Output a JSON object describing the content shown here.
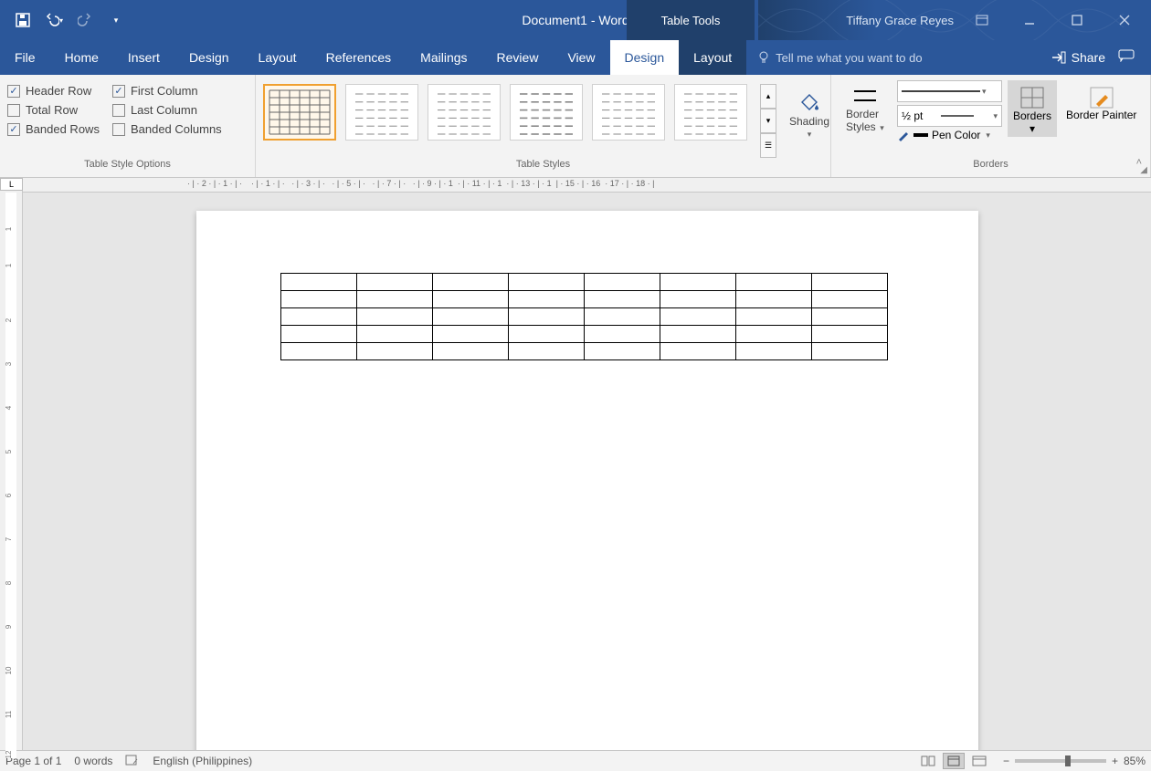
{
  "title": "Document1  -  Word",
  "contextual_tab": "Table Tools",
  "username": "Tiffany Grace Reyes",
  "tabs": {
    "file": "File",
    "home": "Home",
    "insert": "Insert",
    "design": "Design",
    "layout": "Layout",
    "references": "References",
    "mailings": "Mailings",
    "review": "Review",
    "view": "View",
    "design_tt": "Design",
    "layout_tt": "Layout"
  },
  "tellme_placeholder": "Tell me what you want to do",
  "share_label": "Share",
  "ribbon": {
    "opts_group_label": "Table Style Options",
    "opts": {
      "header_row": "Header Row",
      "total_row": "Total Row",
      "banded_rows": "Banded Rows",
      "first_col": "First Column",
      "last_col": "Last Column",
      "banded_cols": "Banded Columns"
    },
    "styles_group_label": "Table Styles",
    "shading_label": "Shading",
    "border_styles_label": "Border Styles",
    "pen_weight": "½ pt",
    "pen_color_label": "Pen Color",
    "borders_group_label": "Borders",
    "borders_label": "Borders",
    "border_painter_label": "Border Painter"
  },
  "status": {
    "page": "Page 1 of 1",
    "words": "0 words",
    "lang": "English (Philippines)",
    "zoom_pct": "85%"
  },
  "doc_table": {
    "rows": 5,
    "cols": 8
  }
}
